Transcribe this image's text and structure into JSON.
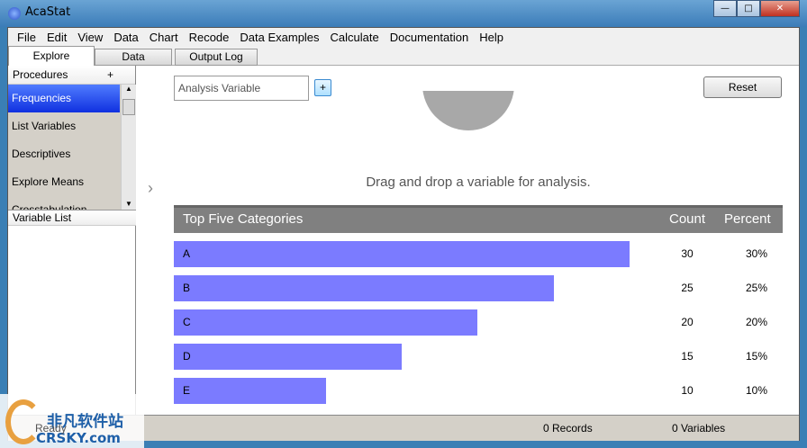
{
  "window": {
    "title": "AcaStat"
  },
  "menu": [
    "File",
    "Edit",
    "View",
    "Data",
    "Chart",
    "Recode",
    "Data Examples",
    "Calculate",
    "Documentation",
    "Help"
  ],
  "tabs": [
    "Explore",
    "Data",
    "Output Log"
  ],
  "procedures": {
    "header": "Procedures",
    "add": "+",
    "items": [
      "Frequencies",
      "List Variables",
      "Descriptives",
      "Explore Means",
      "Crosstabulation"
    ]
  },
  "variable_list": {
    "header": "Variable List"
  },
  "main": {
    "analysis_placeholder": "Analysis Variable",
    "add": "+",
    "reset": "Reset",
    "drag_message": "Drag and drop a variable for analysis.",
    "expand": "›"
  },
  "table": {
    "title": "Top Five Categories",
    "count_header": "Count",
    "percent_header": "Percent",
    "rows": [
      {
        "label": "A",
        "count": "30",
        "percent": "30%",
        "value": 30
      },
      {
        "label": "B",
        "count": "25",
        "percent": "25%",
        "value": 25
      },
      {
        "label": "C",
        "count": "20",
        "percent": "20%",
        "value": 20
      },
      {
        "label": "D",
        "count": "15",
        "percent": "15%",
        "value": 15
      },
      {
        "label": "E",
        "count": "10",
        "percent": "10%",
        "value": 10
      }
    ],
    "max": 30
  },
  "status": {
    "ready": "Ready",
    "records": "0 Records",
    "variables": "0 Variables"
  },
  "watermark": {
    "cn": "非凡软件站",
    "en": "CRSKY.com"
  }
}
